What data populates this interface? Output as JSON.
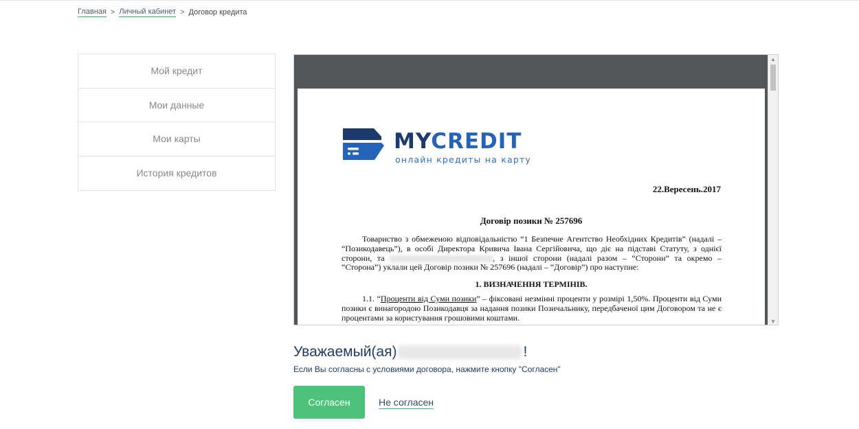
{
  "breadcrumb": {
    "items": [
      "Главная",
      "Личный кабинет"
    ],
    "current": "Договор кредита",
    "separator": ">"
  },
  "sidebar": {
    "items": [
      {
        "label": "Мой кредит"
      },
      {
        "label": "Мои данные"
      },
      {
        "label": "Мои карты"
      },
      {
        "label": "История кредитов"
      }
    ]
  },
  "document": {
    "logo": {
      "brand_my": "MY",
      "brand_credit": "CREDIT",
      "tagline": "онлайн кредиты на карту"
    },
    "date": "22.Вересень.2017",
    "title": "Договір позики № 257696",
    "paragraph1_part1": "Товариство з обмеженою відповідальністю “1 Безпечне Агентство Необхідних Кредитів” (надалі – “Позикодавець”), в особі Директора Кривича Івана Сергійовича, що діє на підставі Статуту, з однієї сторони, та",
    "paragraph1_part2": ", з іншої сторони (надалі разом – “Сторони” та окремо – “Сторона”) уклали цей Договір позики № 257696 (надалі – “Договір”) про наступне:",
    "section_heading": "1. ВИЗНАЧЕННЯ ТЕРМІНІВ.",
    "paragraph2_num": "1.1. “",
    "paragraph2_term": "Проценти від Суми позики",
    "paragraph2_rest": "” – фіксовані незмінні проценти у розмірі 1,50%. Проценти від Суми позики є винагородою Позикодавця за надання позики Позичальнику, передбаченої цим Договором та не є процентами за користування грошовими коштами."
  },
  "greeting": {
    "prefix": "Уважаемый(ая)",
    "suffix": "!",
    "instruction": "Если Вы согласны с условиями договора, нажмите кнопку \"Согласен\""
  },
  "actions": {
    "agree_label": "Согласен",
    "disagree_label": "Не согласен"
  },
  "colors": {
    "accent_green": "#4cc27a",
    "link_underline": "#3cb371",
    "brand_dark_blue": "#1d3a6e",
    "brand_blue": "#2563b8",
    "viewer_background": "#525659"
  }
}
